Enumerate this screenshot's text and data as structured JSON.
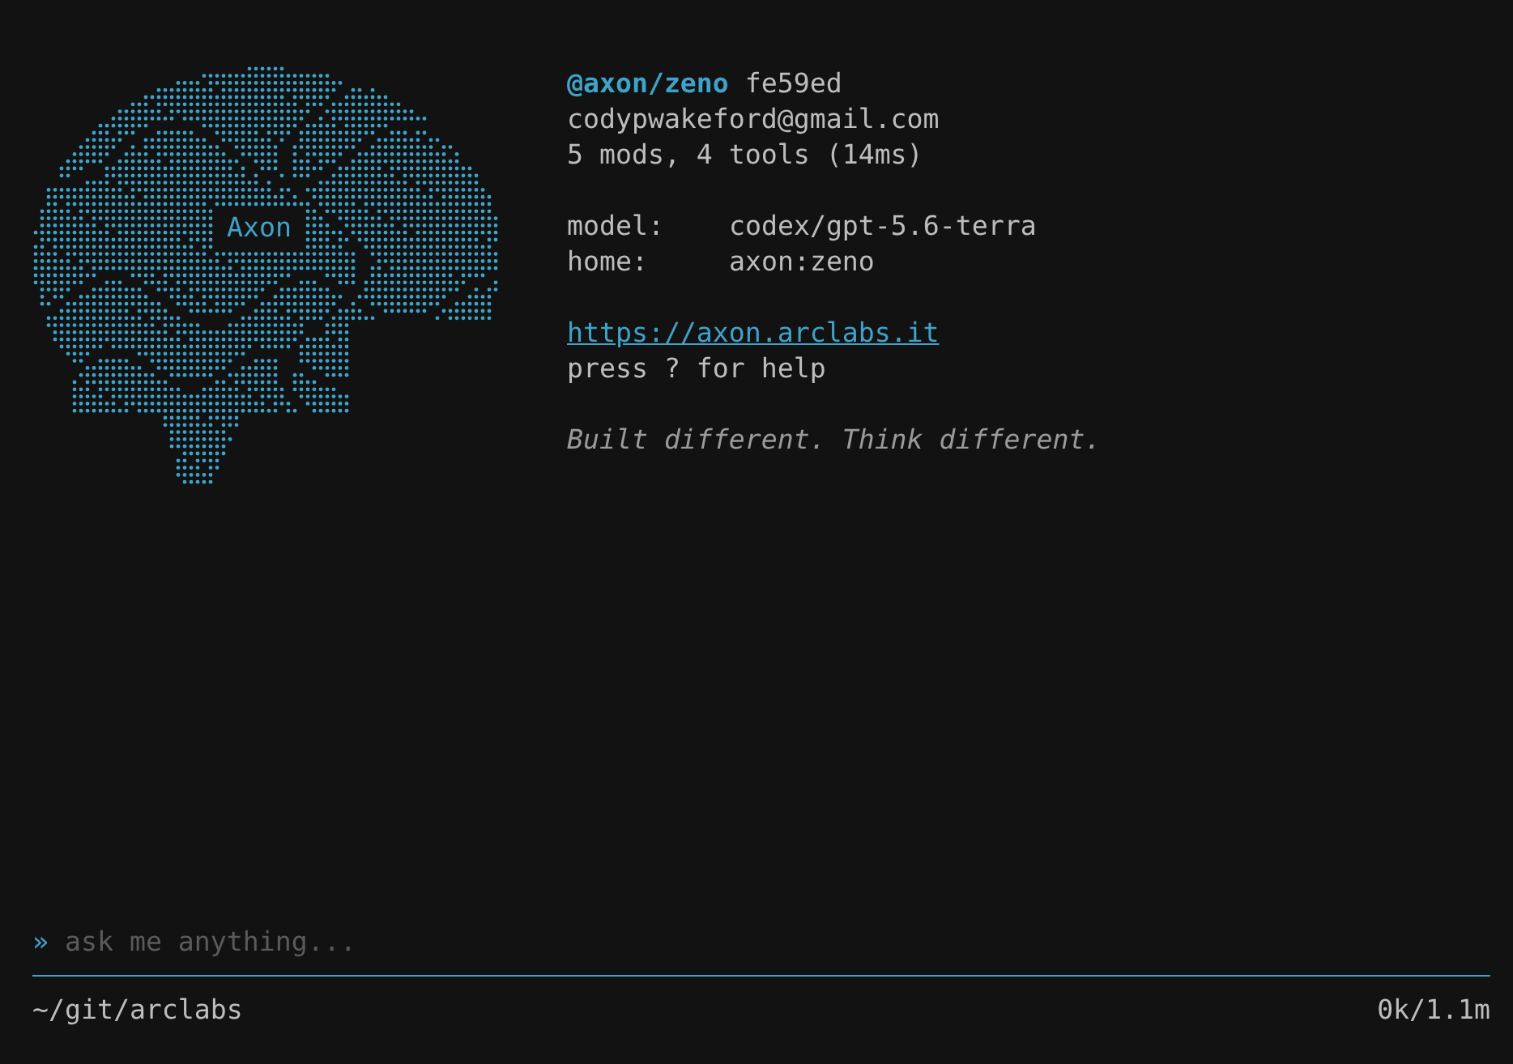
{
  "logo_label": "Axon",
  "header": {
    "name": "@axon/zeno",
    "hash": "fe59ed"
  },
  "email": "codypwakeford@gmail.com",
  "stats": "5 mods, 4 tools (14ms)",
  "settings": [
    {
      "key": "model:",
      "value": "codex/gpt-5.6-terra"
    },
    {
      "key": "home:",
      "value": "axon:zeno"
    }
  ],
  "link": "https://axon.arclabs.it",
  "help": "press ? for help",
  "tagline": "Built different. Think different.",
  "prompt": {
    "symbol": "»",
    "placeholder": "ask me anything..."
  },
  "status_bar": {
    "path": "~/git/arclabs",
    "tokens": "0k/1.1m"
  }
}
